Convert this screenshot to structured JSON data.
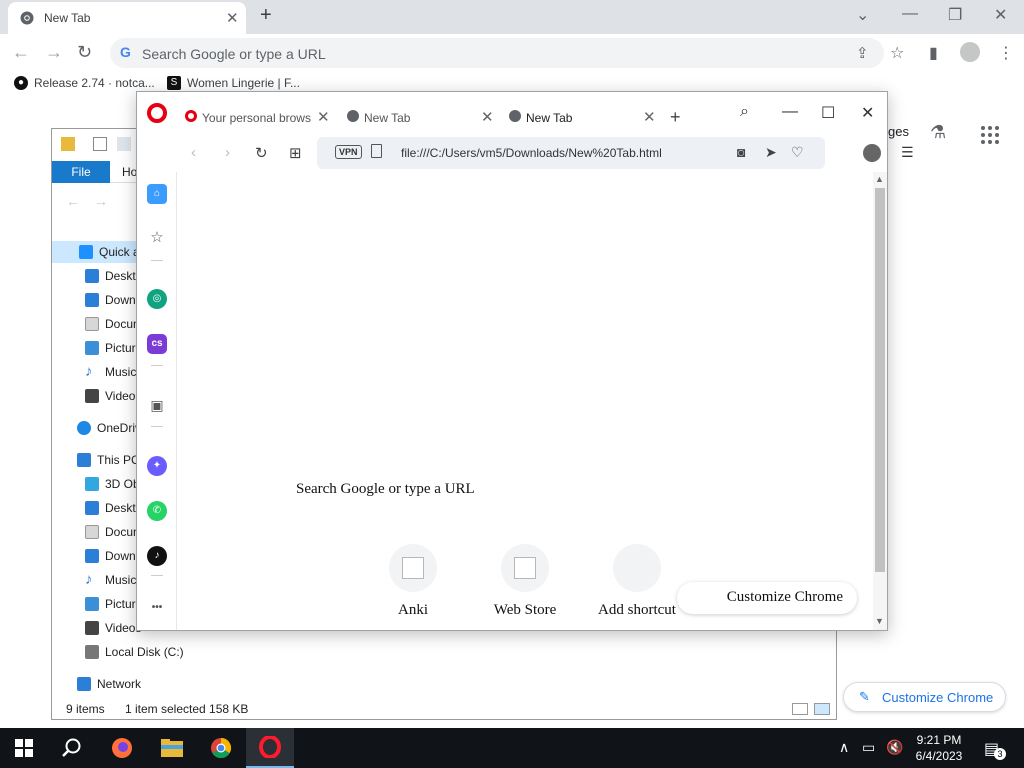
{
  "chrome": {
    "tab_title": "New Tab",
    "omnibox_placeholder": "Search Google or type a URL",
    "bookmarks": [
      {
        "label": "Release 2.74 · notca..."
      },
      {
        "label": "Women Lingerie | F..."
      }
    ],
    "ntp_partial_text": "ges",
    "customize_label": "Customize Chrome"
  },
  "explorer": {
    "file_tab": "File",
    "home_tab": "Ho",
    "tree": [
      {
        "label": "Quick a",
        "icon": "star-icon",
        "color": "#1e90ff"
      },
      {
        "label": "Deskto",
        "icon": "desktop-icon",
        "color": "#2b7fd6"
      },
      {
        "label": "Down",
        "icon": "download-icon",
        "color": "#2b7fd6"
      },
      {
        "label": "Docun",
        "icon": "document-icon",
        "color": "#9e9e9e"
      },
      {
        "label": "Pictur",
        "icon": "pictures-icon",
        "color": "#3b8fd6"
      },
      {
        "label": "Music",
        "icon": "music-icon",
        "color": "#2b7fd6"
      },
      {
        "label": "Video",
        "icon": "video-icon",
        "color": "#444444"
      },
      {
        "label": "OneDriv",
        "icon": "cloud-icon",
        "color": "#1e88e5"
      },
      {
        "label": "This PC",
        "icon": "pc-icon",
        "color": "#2b7fd6"
      },
      {
        "label": "3D Ob",
        "icon": "cube-icon",
        "color": "#32a7e0"
      },
      {
        "label": "Deskto",
        "icon": "desktop-icon",
        "color": "#2b7fd6"
      },
      {
        "label": "Docun",
        "icon": "document-icon",
        "color": "#9e9e9e"
      },
      {
        "label": "Down",
        "icon": "download-icon",
        "color": "#2b7fd6"
      },
      {
        "label": "Music",
        "icon": "music-icon",
        "color": "#2b7fd6"
      },
      {
        "label": "Pictur",
        "icon": "pictures-icon",
        "color": "#3b8fd6"
      },
      {
        "label": "Videos",
        "icon": "video-icon",
        "color": "#444444"
      },
      {
        "label": "Local Disk (C:)",
        "icon": "drive-icon",
        "color": "#777777"
      },
      {
        "label": "Network",
        "icon": "network-icon",
        "color": "#2b7fd6"
      }
    ],
    "status_items": "9 items",
    "status_selected": "1 item selected  158 KB"
  },
  "opera": {
    "tabs": [
      {
        "title": "Your personal brows",
        "active": false
      },
      {
        "title": "New Tab",
        "active": false
      },
      {
        "title": "New Tab",
        "active": true
      }
    ],
    "vpn_label": "VPN",
    "url": "file:///C:/Users/vm5/Downloads/New%20Tab.html",
    "search_text": "Search Google or type a URL",
    "shortcuts": [
      {
        "label": "Anki"
      },
      {
        "label": "Web Store"
      },
      {
        "label": "Add shortcut"
      }
    ],
    "customize_label": "Customize Chrome"
  },
  "taskbar": {
    "time": "9:21 PM",
    "date": "6/4/2023",
    "notification_count": "3"
  }
}
